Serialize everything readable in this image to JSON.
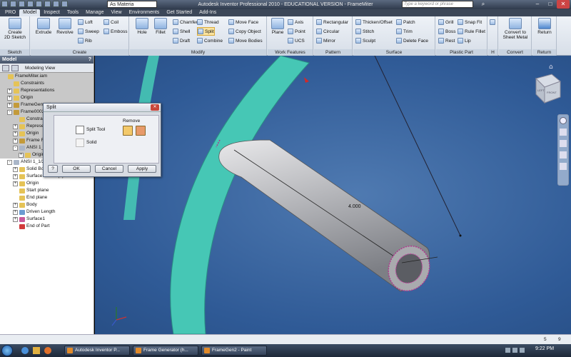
{
  "window": {
    "title": "Autodesk Inventor Professional 2010 - EDUCATIONAL VERSION - FrameMiter",
    "material": "As Materia",
    "search_placeholder": "Type a keyword or phrase"
  },
  "ribbon_tabs": [
    "PRO",
    "Model",
    "Inspect",
    "Tools",
    "Manage",
    "View",
    "Environments",
    "Get Started",
    "Add-Ins"
  ],
  "ribbon": {
    "sketch": {
      "label": "Sketch",
      "create": "Create",
      "create2": "2D Sketch"
    },
    "create": {
      "label": "Create",
      "extrude": "Extrude",
      "revolve": "Revolve",
      "loft": "Loft",
      "sweep": "Sweep",
      "rib": "Rib",
      "coil": "Coil",
      "emboss": "Emboss"
    },
    "modify": {
      "label": "Modify",
      "hole": "Hole",
      "fillet": "Fillet",
      "chamfer": "Chamfer",
      "shell": "Shell",
      "draft": "Draft",
      "thread": "Thread",
      "split": "Split",
      "combine": "Combine",
      "move_face": "Move Face",
      "copy_object": "Copy Object",
      "move_bodies": "Move Bodies"
    },
    "work_features": {
      "label": "Work Features",
      "plane": "Plane",
      "axis": "Axis",
      "point": "Point",
      "ucs": "UCS"
    },
    "pattern": {
      "label": "Pattern",
      "rectangular": "Rectangular",
      "circular": "Circular",
      "mirror": "Mirror"
    },
    "surface": {
      "label": "Surface",
      "thicken": "Thicken/Offset",
      "stitch": "Stitch",
      "sculpt": "Sculpt",
      "patch": "Patch",
      "trim": "Trim",
      "delete_face": "Delete Face"
    },
    "plastic_part": {
      "label": "Plastic Part",
      "grill": "Grill",
      "boss": "Boss",
      "rest": "Rest",
      "snap_fit": "Snap Fit",
      "rule_fillet": "Rule Fillet",
      "lip": "Lip"
    },
    "h": {
      "label": "H"
    },
    "convert": {
      "label": "Convert",
      "btn1": "Convert to",
      "btn2": "Sheet Metal"
    },
    "return": {
      "label": "Return",
      "btn": "Return"
    }
  },
  "browser": {
    "title": "Model",
    "view": "Modeling View",
    "items": [
      {
        "label": "FrameMiter.iam",
        "indent": 0,
        "exp": "",
        "gray": true,
        "icon": "#e5c357"
      },
      {
        "label": "Constraints",
        "indent": 1,
        "exp": "",
        "gray": true,
        "icon": "#e5c357"
      },
      {
        "label": "Representations",
        "indent": 1,
        "exp": "+",
        "gray": true,
        "icon": "#e5c357"
      },
      {
        "label": "Origin",
        "indent": 1,
        "exp": "+",
        "gray": true,
        "icon": "#e5c357"
      },
      {
        "label": "FrameGenerator",
        "indent": 1,
        "exp": "+",
        "gray": true,
        "icon": "#c39a3a"
      },
      {
        "label": "Frame0002:1",
        "indent": 1,
        "exp": "-",
        "gray": true,
        "icon": "#c39a3a"
      },
      {
        "label": "Constraints",
        "indent": 2,
        "exp": "",
        "gray": true,
        "icon": "#e5c357"
      },
      {
        "label": "Representations",
        "indent": 2,
        "exp": "+",
        "gray": true,
        "icon": "#e5c357"
      },
      {
        "label": "Origin",
        "indent": 2,
        "exp": "+",
        "gray": true,
        "icon": "#e5c357"
      },
      {
        "label": "Frame Reference",
        "indent": 2,
        "exp": "+",
        "gray": true,
        "icon": "#c39a3a"
      },
      {
        "label": "ANSI 1_1/2 ...",
        "indent": 2,
        "exp": "-",
        "gray": true,
        "icon": "#aab6c8"
      },
      {
        "label": "Origin",
        "indent": 3,
        "exp": "+",
        "gray": true,
        "icon": "#e5c357"
      },
      {
        "label": "ANSI 1_1/2 ...",
        "indent": 1,
        "exp": "-",
        "gray": false,
        "icon": "#aab6c8"
      },
      {
        "label": "Solid Bodies(1)",
        "indent": 2,
        "exp": "+",
        "gray": false,
        "icon": "#e5c357"
      },
      {
        "label": "Surface Bodies(1)",
        "indent": 2,
        "exp": "+",
        "gray": false,
        "icon": "#e5c357"
      },
      {
        "label": "Origin",
        "indent": 2,
        "exp": "+",
        "gray": false,
        "icon": "#e5c357"
      },
      {
        "label": "Start plane",
        "indent": 2,
        "exp": "",
        "gray": false,
        "icon": "#e5c357"
      },
      {
        "label": "End plane",
        "indent": 2,
        "exp": "",
        "gray": false,
        "icon": "#e5c357"
      },
      {
        "label": "Body",
        "indent": 2,
        "exp": "+",
        "gray": false,
        "icon": "#e5c357"
      },
      {
        "label": "Driven Length",
        "indent": 2,
        "exp": "+",
        "gray": false,
        "icon": "#6b9bd1"
      },
      {
        "label": "Surface1",
        "indent": 2,
        "exp": "+",
        "gray": false,
        "icon": "#c95a9b"
      },
      {
        "label": "End of Part",
        "indent": 2,
        "exp": "",
        "gray": false,
        "icon": "#d23a3a"
      }
    ]
  },
  "dialog": {
    "title": "Split",
    "split_tool": "Split Tool",
    "solid": "Solid",
    "remove": "Remove",
    "ok": "OK",
    "cancel": "Cancel",
    "apply": "Apply",
    "help": "?"
  },
  "viewport": {
    "dimension": "4.000",
    "viewcube_label_left": "LEFT",
    "viewcube_label_front": "FRONT"
  },
  "status": {
    "left": "",
    "n1": "5",
    "n2": "9"
  },
  "taskbar": {
    "tasks": [
      "Autodesk Inventor P...",
      "Frame Generator (h...",
      "FrameGen2 - Paint"
    ],
    "clock": "9:22 PM"
  }
}
